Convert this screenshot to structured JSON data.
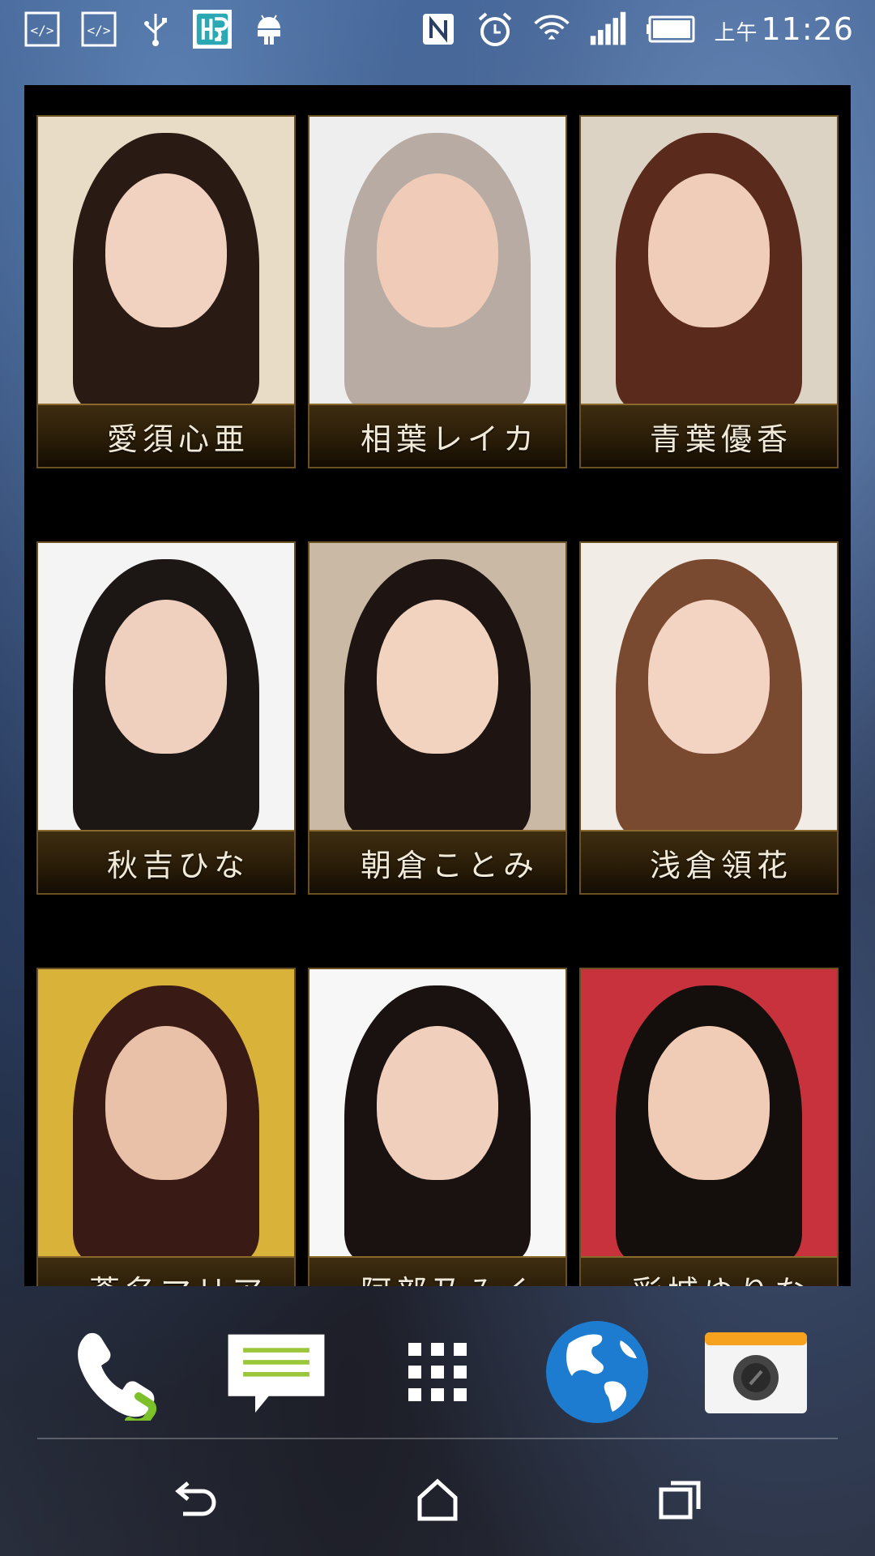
{
  "status_bar": {
    "time_prefix": "上午",
    "time": "11:26",
    "left_icons": [
      "code-icon",
      "code-icon",
      "usb-icon",
      "app-notification-icon",
      "android-icon"
    ],
    "right_icons": [
      "nfc-icon",
      "alarm-icon",
      "wifi-icon",
      "signal-icon",
      "battery-icon"
    ]
  },
  "widget": {
    "cards": [
      {
        "name": "愛須心亜",
        "bg": "#e9dcc6",
        "hair": "#2a1a14",
        "skin": "#f1d2c1"
      },
      {
        "name": "相葉レイカ",
        "bg": "#eeeeee",
        "hair": "#b8aba3",
        "skin": "#f0ccb8"
      },
      {
        "name": "青葉優香",
        "bg": "#dcd3c4",
        "hair": "#5a2a1c",
        "skin": "#f0cdb8"
      },
      {
        "name": "秋吉ひな",
        "bg": "#f4f4f4",
        "hair": "#1c1614",
        "skin": "#efd0bf"
      },
      {
        "name": "朝倉ことみ",
        "bg": "#c9b9a5",
        "hair": "#1e1512",
        "skin": "#f2d3c0"
      },
      {
        "name": "浅倉領花",
        "bg": "#f2ece6",
        "hair": "#7a4a30",
        "skin": "#f3d3c2"
      },
      {
        "name": "蒼名マリア",
        "bg": "#d9b23a",
        "hair": "#3a1a14",
        "skin": "#e9c0a8"
      },
      {
        "name": "阿部乃みく",
        "bg": "#f7f7f7",
        "hair": "#1a1210",
        "skin": "#f0cfbd"
      },
      {
        "name": "彩城ゆりな",
        "bg": "#c8323c",
        "hair": "#140e0c",
        "skin": "#f0cbb5"
      }
    ]
  },
  "dock": {
    "items": [
      "phone-icon",
      "messages-icon",
      "app-drawer-icon",
      "browser-globe-icon",
      "camera-icon"
    ]
  },
  "nav": {
    "items": [
      "back-icon",
      "home-icon",
      "recents-icon"
    ]
  }
}
